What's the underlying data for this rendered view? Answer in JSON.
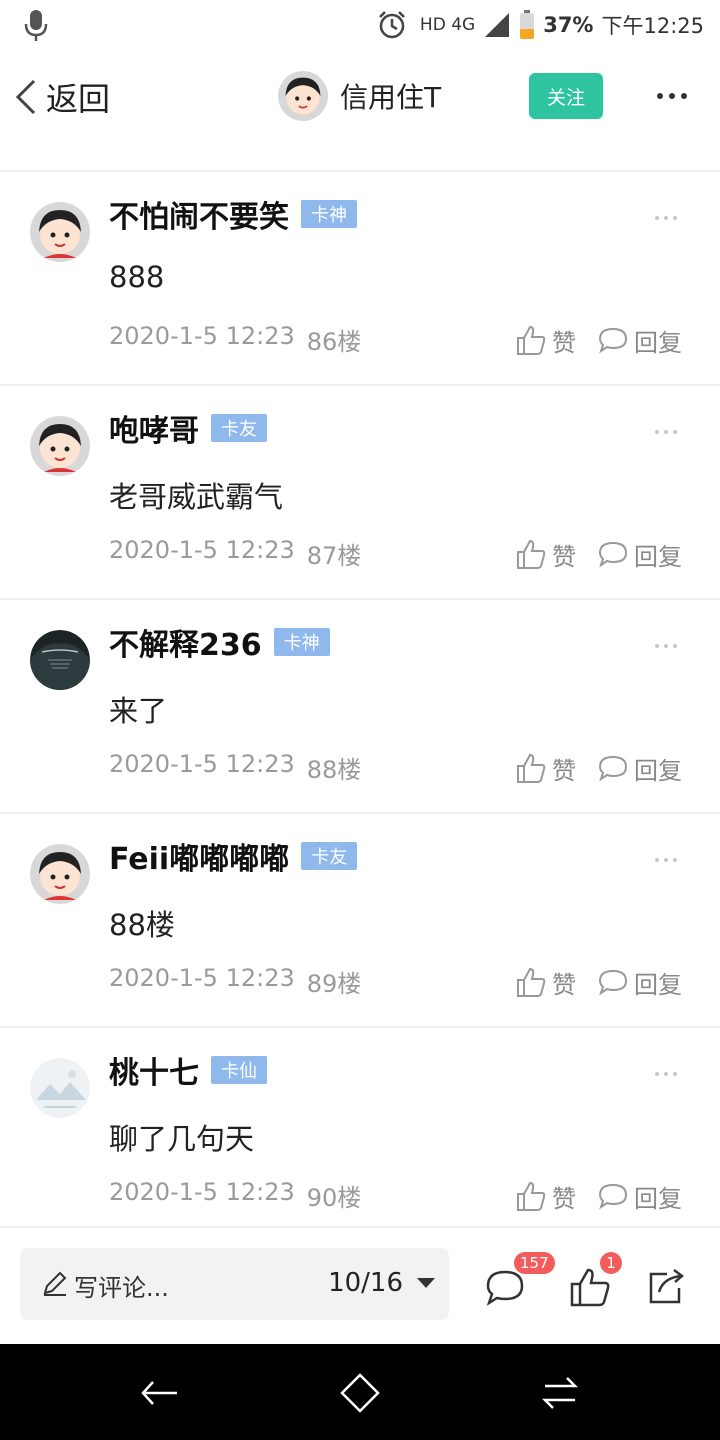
{
  "status_bar": {
    "network": "HD 4G",
    "battery": "37%",
    "time": "下午12:25",
    "icons": [
      "mic-icon",
      "alarm-icon",
      "signal-icon",
      "battery-icon"
    ]
  },
  "nav": {
    "back_label": "返回",
    "author_name": "信用住T",
    "follow_label": "关注"
  },
  "comments": [
    {
      "username": "不怕闹不要笑",
      "badge": "卡神",
      "text": "888",
      "time": "2020-1-5 12:23",
      "floor": "86楼",
      "like_label": "赞",
      "reply_label": "回复"
    },
    {
      "username": "咆哮哥",
      "badge": "卡友",
      "text": "老哥威武霸气",
      "time": "2020-1-5 12:23",
      "floor": "87楼",
      "like_label": "赞",
      "reply_label": "回复"
    },
    {
      "username": "不解释236",
      "badge": "卡神",
      "text": "来了",
      "time": "2020-1-5 12:23",
      "floor": "88楼",
      "like_label": "赞",
      "reply_label": "回复"
    },
    {
      "username": "Feii嘟嘟嘟嘟",
      "badge": "卡友",
      "text": "88楼",
      "time": "2020-1-5 12:23",
      "floor": "89楼",
      "like_label": "赞",
      "reply_label": "回复"
    },
    {
      "username": "桃十七",
      "badge": "卡仙",
      "text": "聊了几句天",
      "time": "2020-1-5 12:23",
      "floor": "90楼",
      "like_label": "赞",
      "reply_label": "回复"
    }
  ],
  "bottom_bar": {
    "write_placeholder": "写评论...",
    "pager": "10/16",
    "comment_count": "157",
    "like_count": "1"
  },
  "colors": {
    "follow_button": "#2ec4a0",
    "badge": "#8fb8ec",
    "count_badge": "#f25c5c"
  }
}
